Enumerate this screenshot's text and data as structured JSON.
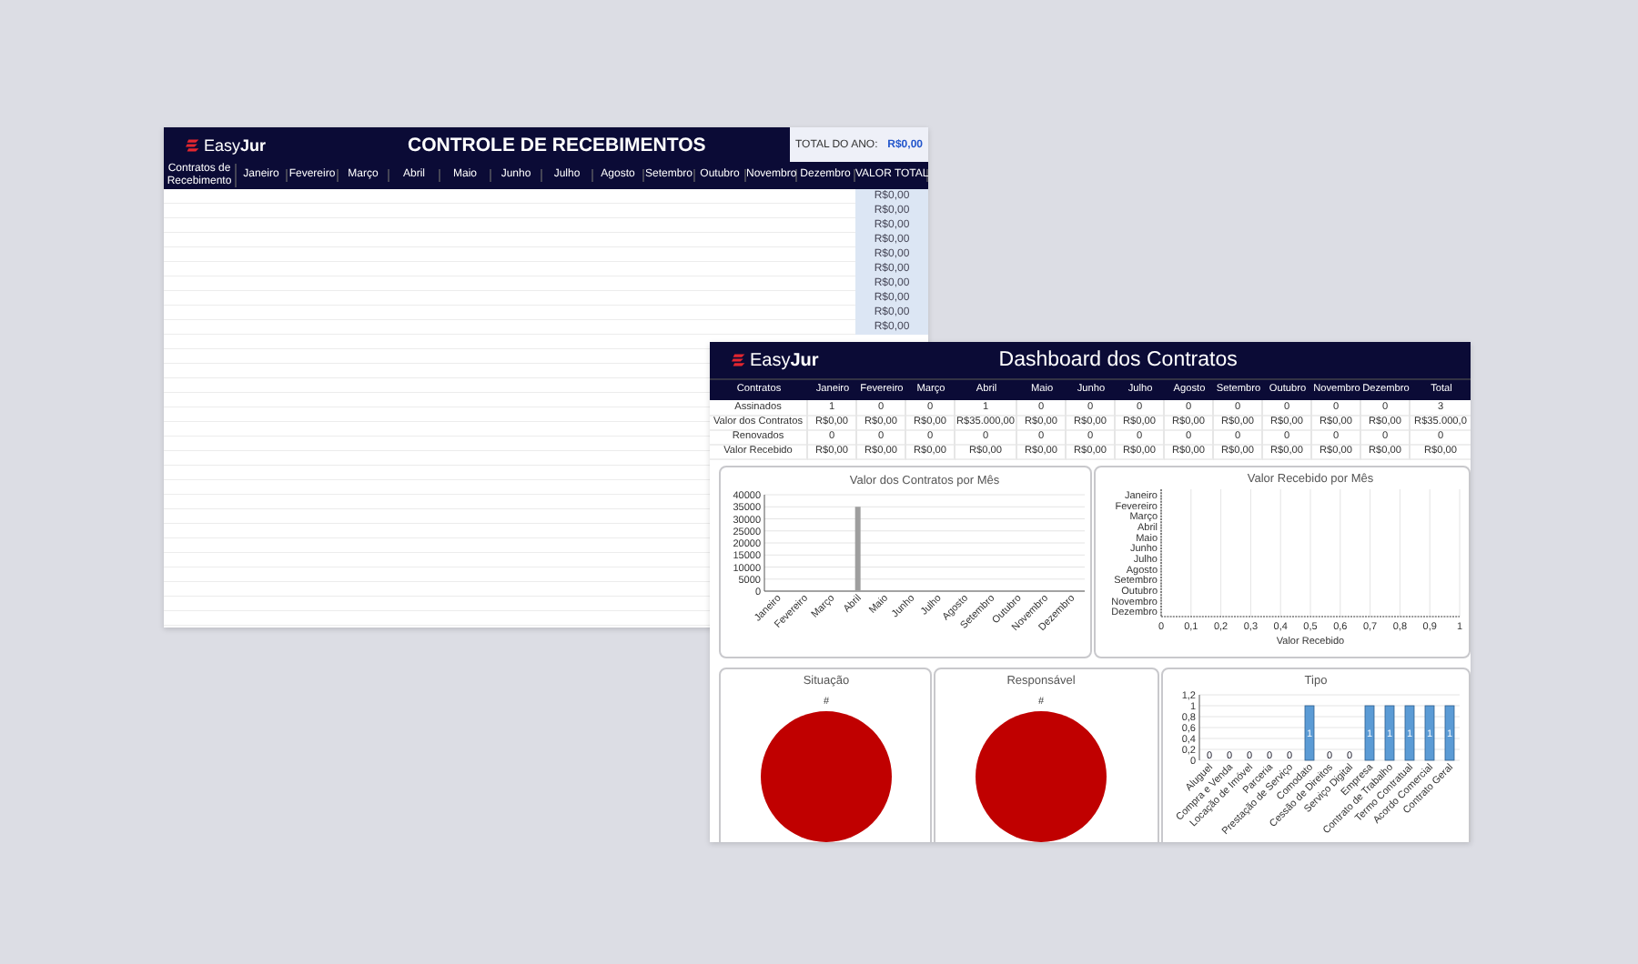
{
  "recebimentos": {
    "logo": "Easy**Jur**",
    "title": "CONTROLE DE RECEBIMENTOS",
    "total_label": "TOTAL DO ANO:",
    "total_value": "R$0,00",
    "columns": [
      "Contratos de Recebimento",
      "Janeiro",
      "Fevereiro",
      "Março",
      "Abril",
      "Maio",
      "Junho",
      "Julho",
      "Agosto",
      "Setembro",
      "Outubro",
      "Novembro",
      "Dezembro",
      "VALOR TOTAL"
    ],
    "row_totals": [
      "R$0,00",
      "R$0,00",
      "R$0,00",
      "R$0,00",
      "R$0,00",
      "R$0,00",
      "R$0,00",
      "R$0,00",
      "R$0,00",
      "R$0,00"
    ]
  },
  "dashboard": {
    "logo": "Easy**Jur**",
    "title": "Dashboard dos Contratos",
    "columns": [
      "Contratos",
      "Janeiro",
      "Fevereiro",
      "Março",
      "Abril",
      "Maio",
      "Junho",
      "Julho",
      "Agosto",
      "Setembro",
      "Outubro",
      "Novembro",
      "Dezembro",
      "Total"
    ],
    "rows": [
      [
        "Assinados",
        "1",
        "0",
        "0",
        "1",
        "0",
        "0",
        "0",
        "0",
        "0",
        "0",
        "0",
        "0",
        "3"
      ],
      [
        "Valor dos Contratos",
        "R$0,00",
        "R$0,00",
        "R$0,00",
        "R$35.000,00",
        "R$0,00",
        "R$0,00",
        "R$0,00",
        "R$0,00",
        "R$0,00",
        "R$0,00",
        "R$0,00",
        "R$0,00",
        "R$35.000,0"
      ],
      [
        "Renovados",
        "0",
        "0",
        "0",
        "0",
        "0",
        "0",
        "0",
        "0",
        "0",
        "0",
        "0",
        "0",
        "0"
      ],
      [
        "Valor Recebido",
        "R$0,00",
        "R$0,00",
        "R$0,00",
        "R$0,00",
        "R$0,00",
        "R$0,00",
        "R$0,00",
        "R$0,00",
        "R$0,00",
        "R$0,00",
        "R$0,00",
        "R$0,00",
        "R$0,00"
      ]
    ],
    "contratos_chart": {
      "chart_data": {
        "type": "bar",
        "title": "Valor dos Contratos por Mês",
        "grid": true,
        "categories": [
          "Janeiro",
          "Fevereiro",
          "Março",
          "Abril",
          "Maio",
          "Junho",
          "Julho",
          "Agosto",
          "Setembro",
          "Outubro",
          "Novembro",
          "Dezembro"
        ],
        "values": [
          0,
          0,
          0,
          35000,
          0,
          0,
          0,
          0,
          0,
          0,
          0,
          0
        ],
        "ylim": [
          0,
          40000
        ],
        "yticks": [
          0,
          5000,
          10000,
          15000,
          20000,
          25000,
          30000,
          35000,
          40000
        ]
      }
    },
    "recebido_chart": {
      "chart_data": {
        "type": "bar",
        "orientation": "horizontal",
        "grid": true,
        "title": "Valor Recebido por Mês",
        "xlabel": "Valor Recebido",
        "categories": [
          "Janeiro",
          "Fevereiro",
          "Março",
          "Abril",
          "Maio",
          "Junho",
          "Julho",
          "Agosto",
          "Setembro",
          "Outubro",
          "Novembro",
          "Dezembro"
        ],
        "values": [
          0,
          0,
          0,
          0,
          0,
          0,
          0,
          0,
          0,
          0,
          0,
          0
        ],
        "xlim": [
          0,
          1
        ],
        "xticks": [
          {
            "value": 0,
            "label": "0"
          },
          {
            "value": 0.1,
            "label": "0,1"
          },
          {
            "value": 0.2,
            "label": "0,2"
          },
          {
            "value": 0.3,
            "label": "0,3"
          },
          {
            "value": 0.4,
            "label": "0,4"
          },
          {
            "value": 0.5,
            "label": "0,5"
          },
          {
            "value": 0.6,
            "label": "0,6"
          },
          {
            "value": 0.7,
            "label": "0,7"
          },
          {
            "value": 0.8,
            "label": "0,8"
          },
          {
            "value": 0.9,
            "label": "0,9"
          },
          {
            "value": 1,
            "label": "1"
          }
        ]
      }
    },
    "pies": [
      {
        "title": "Situação",
        "label": "#"
      },
      {
        "title": "Responsável",
        "label": "#"
      }
    ],
    "tipo_chart": {
      "chart_data": {
        "type": "bar",
        "title": "Tipo",
        "grid": true,
        "data_labels": true,
        "categories": [
          "Aluguel",
          "Compra e Venda",
          "Locação de Imóvel",
          "Parceria",
          "Prestação de Serviço",
          "Comodato",
          "Cessão de Direitos",
          "Serviço Digital",
          "Empresa",
          "Contrato de Trabalho",
          "Termo Contratual",
          "Acordo Comercial",
          "Contrato Geral"
        ],
        "values": [
          0,
          0,
          0,
          0,
          0,
          1,
          0,
          0,
          1,
          1,
          1,
          1,
          1
        ],
        "ylim": [
          0,
          1.2
        ],
        "yticks": [
          {
            "value": 0,
            "label": "0"
          },
          {
            "value": 0.2,
            "label": "0,2"
          },
          {
            "value": 0.4,
            "label": "0,4"
          },
          {
            "value": 0.6,
            "label": "0,6"
          },
          {
            "value": 0.8,
            "label": "0,8"
          },
          {
            "value": 1,
            "label": "1"
          },
          {
            "value": 1.2,
            "label": "1,2"
          }
        ]
      }
    }
  }
}
